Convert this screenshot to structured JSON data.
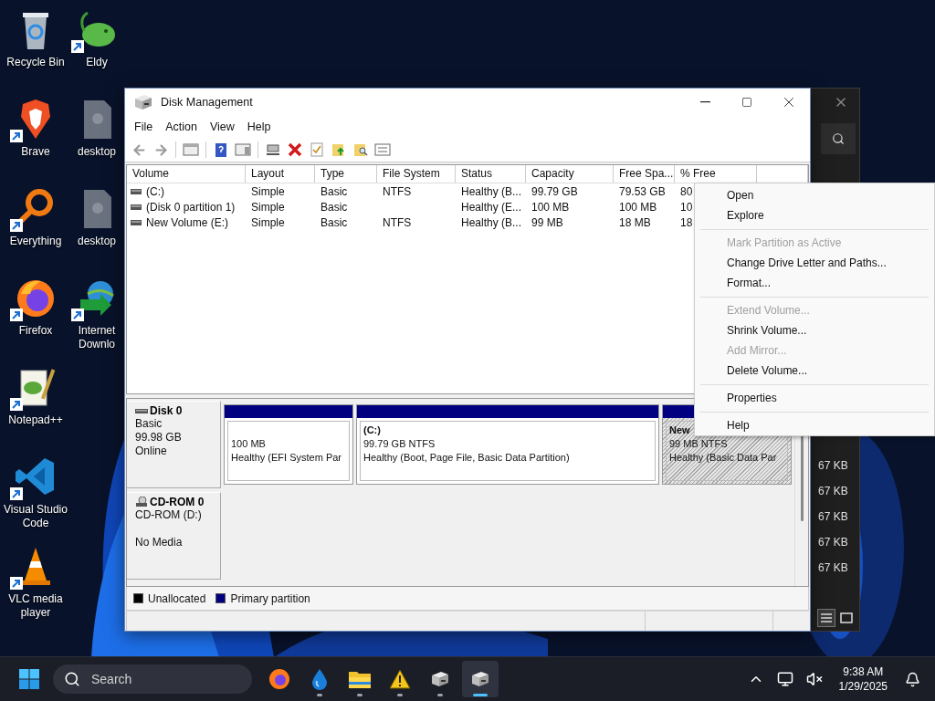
{
  "desktop_icon_columns": [
    [
      {
        "label": "Recycle Bin",
        "kind": "recycle",
        "shortcut": false
      },
      {
        "label": "Brave",
        "kind": "brave",
        "shortcut": true
      },
      {
        "label": "Everything",
        "kind": "everything",
        "shortcut": true
      },
      {
        "label": "Firefox",
        "kind": "firefox",
        "shortcut": true
      },
      {
        "label": "Notepad++",
        "kind": "notepad",
        "shortcut": true
      },
      {
        "label": "Visual Studio Code",
        "kind": "vscode",
        "shortcut": true
      },
      {
        "label": "VLC media player",
        "kind": "vlc",
        "shortcut": true
      }
    ],
    [
      {
        "label": "Eldy",
        "kind": "eldy",
        "shortcut": true
      },
      {
        "label": "desktop",
        "kind": "file",
        "shortcut": false
      },
      {
        "label": "desktop",
        "kind": "file",
        "shortcut": false
      },
      {
        "label": "Internet Downlo",
        "kind": "idm",
        "shortcut": true
      }
    ]
  ],
  "background_window": {
    "rows": [
      "67 KB",
      "67 KB",
      "67 KB",
      "67 KB",
      "67 KB"
    ]
  },
  "disk_management": {
    "title": "Disk Management",
    "menu": [
      "File",
      "Action",
      "View",
      "Help"
    ],
    "volume_table": {
      "columns": [
        "Volume",
        "Layout",
        "Type",
        "File System",
        "Status",
        "Capacity",
        "Free Spa...",
        "% Free"
      ],
      "rows": [
        [
          "(C:)",
          "Simple",
          "Basic",
          "NTFS",
          "Healthy (B...",
          "99.79 GB",
          "79.53 GB",
          "80"
        ],
        [
          "(Disk 0 partition 1)",
          "Simple",
          "Basic",
          "",
          "Healthy (E...",
          "100 MB",
          "100 MB",
          "10"
        ],
        [
          "New Volume (E:)",
          "Simple",
          "Basic",
          "NTFS",
          "Healthy (B...",
          "99 MB",
          "18 MB",
          "18"
        ]
      ]
    },
    "disks": [
      {
        "name": "Disk 0",
        "kind": "disk",
        "type": "Basic",
        "size": "99.98 GB",
        "status": "Online",
        "partitions": [
          {
            "size": "100 MB",
            "status": "Healthy (EFI System Par",
            "selected": false
          },
          {
            "name": "(C:)",
            "size": "99.79 GB NTFS",
            "status": "Healthy (Boot, Page File, Basic Data Partition)",
            "selected": false
          },
          {
            "name": "New",
            "size": "99 MB NTFS",
            "status": "Healthy (Basic Data Par",
            "selected": true
          }
        ]
      },
      {
        "name": "CD-ROM 0",
        "kind": "cdrom",
        "type": "CD-ROM (D:)",
        "status": "No Media"
      }
    ],
    "legend": [
      {
        "label": "Unallocated",
        "color": "#000000"
      },
      {
        "label": "Primary partition",
        "color": "#000080"
      }
    ]
  },
  "context_menu": {
    "groups": [
      [
        {
          "label": "Open",
          "disabled": false
        },
        {
          "label": "Explore",
          "disabled": false
        }
      ],
      [
        {
          "label": "Mark Partition as Active",
          "disabled": true
        },
        {
          "label": "Change Drive Letter and Paths...",
          "disabled": false
        },
        {
          "label": "Format...",
          "disabled": false
        }
      ],
      [
        {
          "label": "Extend Volume...",
          "disabled": true
        },
        {
          "label": "Shrink Volume...",
          "disabled": false
        },
        {
          "label": "Add Mirror...",
          "disabled": true
        },
        {
          "label": "Delete Volume...",
          "disabled": false
        }
      ],
      [
        {
          "label": "Properties",
          "disabled": false
        }
      ],
      [
        {
          "label": "Help",
          "disabled": false
        }
      ]
    ]
  },
  "taskbar": {
    "search": {
      "placeholder": "Search"
    },
    "apps": [
      {
        "kind": "firefox",
        "running": false,
        "selected": false
      },
      {
        "kind": "drop",
        "running": true,
        "selected": false
      },
      {
        "kind": "folder",
        "running": true,
        "selected": false
      },
      {
        "kind": "warning",
        "running": true,
        "selected": false
      },
      {
        "kind": "disk",
        "running": true,
        "selected": false
      },
      {
        "kind": "disk",
        "running": true,
        "selected": true
      }
    ],
    "clock": {
      "time": "9:38 AM",
      "date": "1/29/2025"
    }
  }
}
